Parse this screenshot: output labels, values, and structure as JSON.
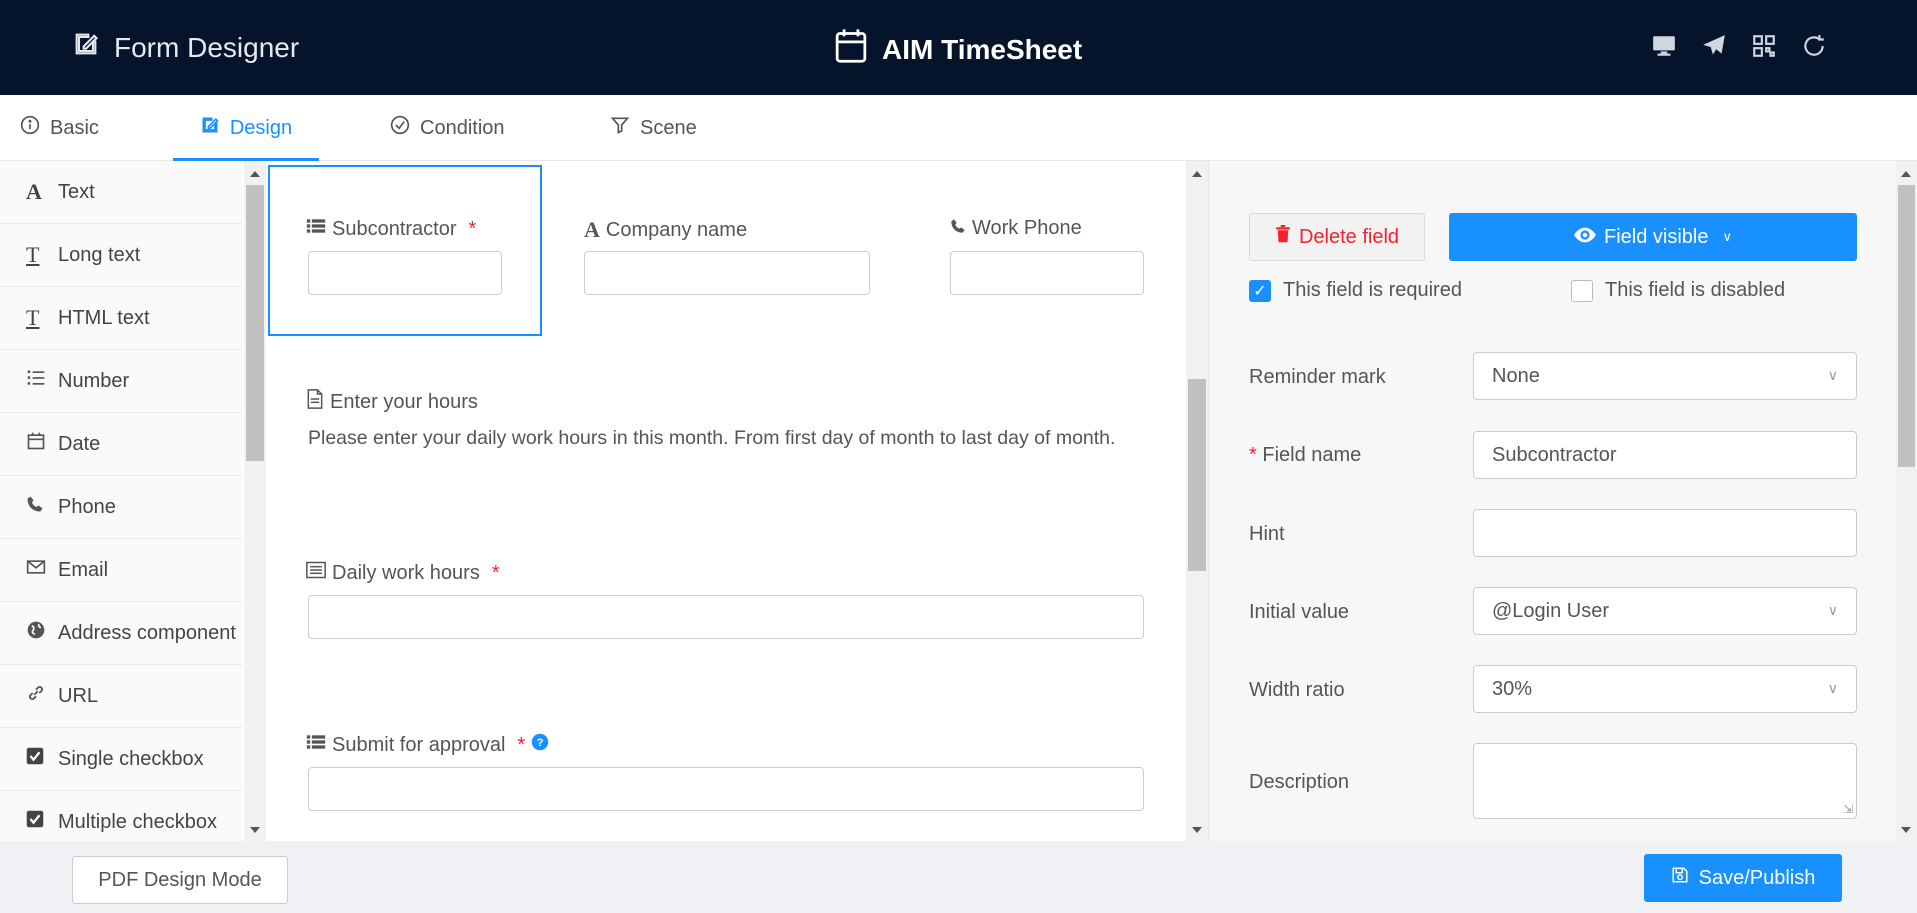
{
  "header": {
    "left_title": "Form Designer",
    "app_title": "AIM TimeSheet",
    "icons": [
      "monitor-icon",
      "send-icon",
      "qrcode-icon",
      "refresh-icon"
    ]
  },
  "tabs": [
    {
      "label": "Basic",
      "icon": "info-icon",
      "active": false
    },
    {
      "label": "Design",
      "icon": "edit-icon",
      "active": true
    },
    {
      "label": "Condition",
      "icon": "check-circle-icon",
      "active": false
    },
    {
      "label": "Scene",
      "icon": "filter-icon",
      "active": false
    }
  ],
  "sidebar": {
    "items": [
      {
        "label": "Text",
        "icon": "font-icon"
      },
      {
        "label": "Long text",
        "icon": "text-height-icon"
      },
      {
        "label": "HTML text",
        "icon": "text-height-icon"
      },
      {
        "label": "Number",
        "icon": "list-ol-icon"
      },
      {
        "label": "Date",
        "icon": "calendar-icon"
      },
      {
        "label": "Phone",
        "icon": "phone-icon"
      },
      {
        "label": "Email",
        "icon": "envelope-icon"
      },
      {
        "label": "Address component",
        "icon": "globe-icon"
      },
      {
        "label": "URL",
        "icon": "link-icon"
      },
      {
        "label": "Single checkbox",
        "icon": "check-square-icon"
      },
      {
        "label": "Multiple checkbox",
        "icon": "check-square-icon"
      }
    ]
  },
  "canvas": {
    "fields": {
      "subcontractor": {
        "label": "Subcontractor",
        "required": "*"
      },
      "company_name": {
        "label": "Company name"
      },
      "work_phone": {
        "label": "Work Phone"
      },
      "enter_hours": {
        "label": "Enter your hours",
        "text": "Please enter your daily work hours in this month. From first day of month to last day of month."
      },
      "daily_hours": {
        "label": "Daily work hours",
        "required": "*"
      },
      "submit_approval": {
        "label": "Submit for approval",
        "required": "*"
      }
    }
  },
  "properties": {
    "delete_label": "Delete field",
    "visible_label": "Field visible",
    "required_label": "This field is required",
    "required_checked": true,
    "disabled_label": "This field is disabled",
    "disabled_checked": false,
    "reminder_label": "Reminder mark",
    "reminder_value": "None",
    "field_name_label": "Field name",
    "field_name_mark": "*",
    "field_name_value": "Subcontractor",
    "hint_label": "Hint",
    "hint_value": "",
    "initial_label": "Initial value",
    "initial_value": "@Login User",
    "width_label": "Width ratio",
    "width_value": "30%",
    "description_label": "Description",
    "description_value": ""
  },
  "footer": {
    "pdf_label": "PDF Design Mode",
    "save_label": "Save/Publish"
  },
  "colors": {
    "header_bg": "#06142b",
    "accent": "#1890ff",
    "danger": "#f5222d"
  }
}
